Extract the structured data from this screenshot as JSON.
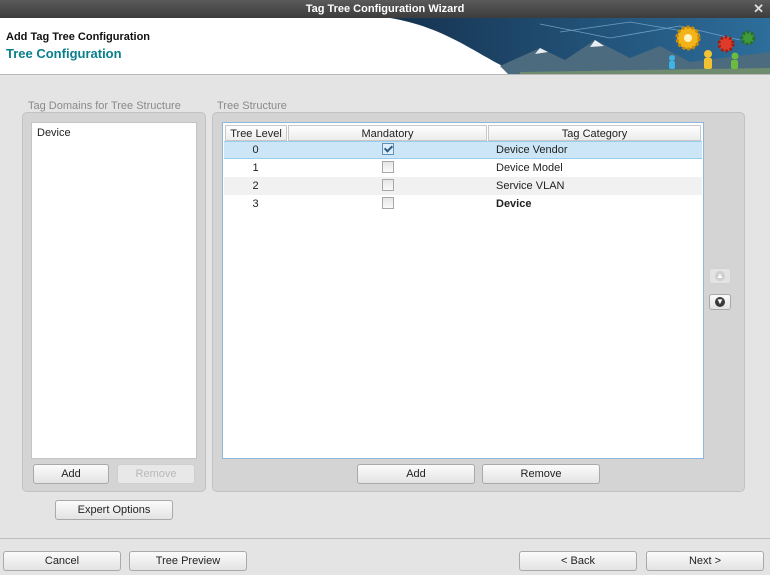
{
  "window": {
    "title": "Tag Tree Configuration Wizard",
    "close_glyph": "✕"
  },
  "header": {
    "subtitle": "Add Tag Tree Configuration",
    "title": "Tree Configuration"
  },
  "domains": {
    "label": "Tag Domains for Tree Structure",
    "items": [
      "Device"
    ],
    "add_label": "Add",
    "remove_label": "Remove"
  },
  "tree": {
    "label": "Tree Structure",
    "columns": [
      "Tree Level",
      "Mandatory",
      "Tag Category"
    ],
    "rows": [
      {
        "level": "0",
        "mandatory": true,
        "category": "Device Vendor",
        "selected": true,
        "bold": false
      },
      {
        "level": "1",
        "mandatory": false,
        "category": "Device Model",
        "selected": false,
        "bold": false
      },
      {
        "level": "2",
        "mandatory": false,
        "category": "Service VLAN",
        "selected": false,
        "bold": false
      },
      {
        "level": "3",
        "mandatory": false,
        "category": "Device",
        "selected": false,
        "bold": true
      }
    ],
    "add_label": "Add",
    "remove_label": "Remove",
    "move_up_icon": "arrow-up-circle-icon",
    "move_down_icon": "arrow-down-circle-icon"
  },
  "expert_options_label": "Expert Options",
  "footer": {
    "cancel_label": "Cancel",
    "preview_label": "Tree Preview",
    "back_label": "< Back",
    "next_label": "Next >"
  },
  "colors": {
    "accent": "#0a7f8c",
    "selection": "#cce6f7",
    "titlebar": "#4a4a4a"
  }
}
